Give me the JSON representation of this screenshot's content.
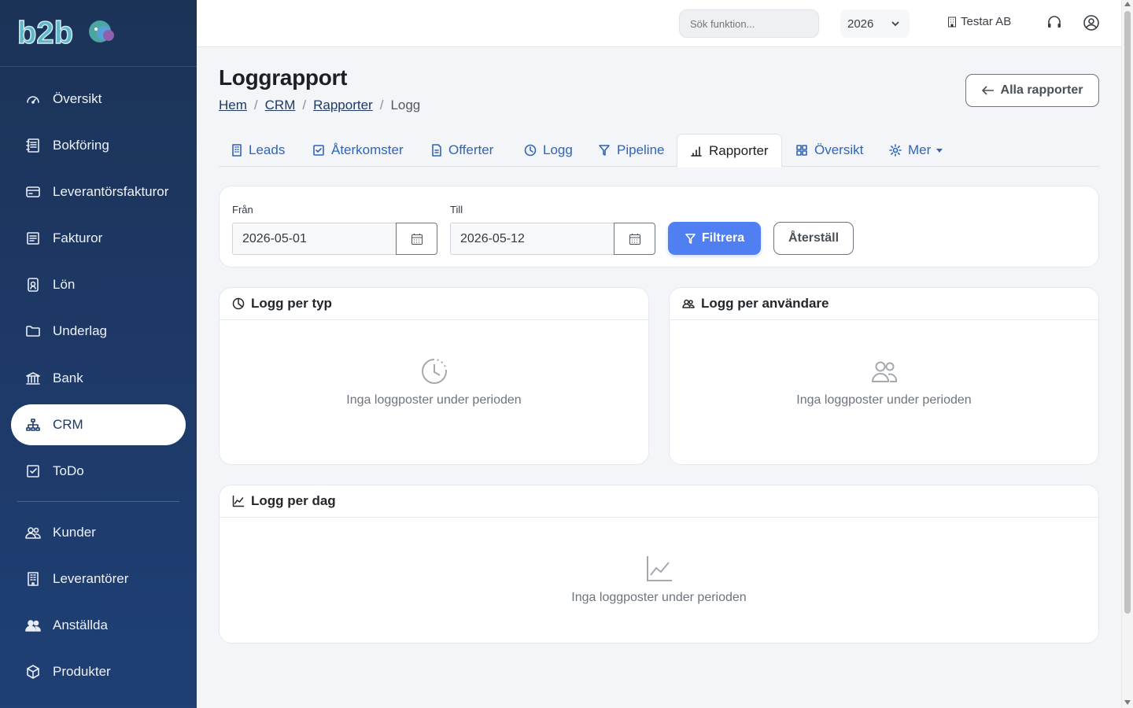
{
  "app": {
    "logo_text": "b2b"
  },
  "sidebar": {
    "items": [
      {
        "label": "Översikt",
        "icon": "gauge-icon"
      },
      {
        "label": "Bokföring",
        "icon": "journal-icon"
      },
      {
        "label": "Leverantörsfakturor",
        "icon": "credit-card-icon"
      },
      {
        "label": "Fakturor",
        "icon": "invoice-icon"
      },
      {
        "label": "Lön",
        "icon": "badge-icon"
      },
      {
        "label": "Underlag",
        "icon": "folder-icon"
      },
      {
        "label": "Bank",
        "icon": "bank-icon"
      },
      {
        "label": "CRM",
        "icon": "diagram-icon",
        "active": true
      },
      {
        "label": "ToDo",
        "icon": "check-square-icon"
      },
      {
        "label": "Kunder",
        "icon": "people-icon"
      },
      {
        "label": "Leverantörer",
        "icon": "building-icon"
      },
      {
        "label": "Anställda",
        "icon": "people-fill-icon"
      },
      {
        "label": "Produkter",
        "icon": "box-icon"
      }
    ]
  },
  "topbar": {
    "search_placeholder": "Sök funktion...",
    "year": "2026",
    "company": "Testar AB"
  },
  "page": {
    "title": "Loggrapport",
    "breadcrumb": [
      "Hem",
      "CRM",
      "Rapporter",
      "Logg"
    ],
    "back_button": "Alla rapporter"
  },
  "tabs": [
    {
      "label": "Leads",
      "icon": "building-icon"
    },
    {
      "label": "Återkomster",
      "icon": "check-square-icon"
    },
    {
      "label": "Offerter",
      "icon": "file-icon"
    },
    {
      "label": "Logg",
      "icon": "clock-icon"
    },
    {
      "label": "Pipeline",
      "icon": "funnel-icon"
    },
    {
      "label": "Rapporter",
      "icon": "bar-chart-icon",
      "active": true
    },
    {
      "label": "Översikt",
      "icon": "grid-icon"
    },
    {
      "label": "Mer",
      "icon": "gear-icon"
    }
  ],
  "filter": {
    "from_label": "Från",
    "from_value": "2026-05-01",
    "to_label": "Till",
    "to_value": "2026-05-12",
    "filter_button": "Filtrera",
    "reset_button": "Återställ"
  },
  "panels": {
    "by_type": {
      "title": "Logg per typ",
      "empty": "Inga loggposter under perioden"
    },
    "by_user": {
      "title": "Logg per användare",
      "empty": "Inga loggposter under perioden"
    },
    "by_day": {
      "title": "Logg per dag",
      "empty": "Inga loggposter under perioden"
    }
  },
  "colors": {
    "sidebar": "#1f3f75",
    "accent": "#4f7ff0",
    "link": "#2f65b8"
  }
}
